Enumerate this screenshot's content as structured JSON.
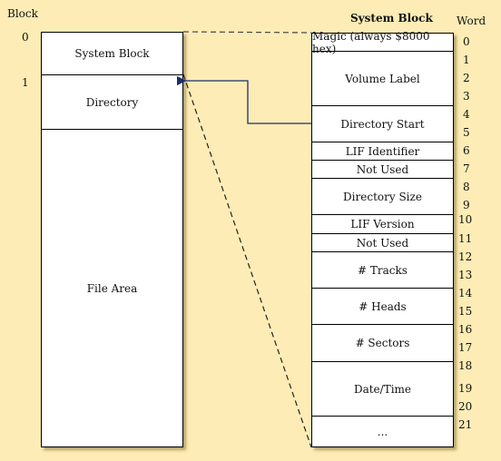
{
  "left": {
    "axis_title": "Block",
    "block_numbers": [
      "0",
      "1"
    ],
    "regions": [
      "System Block",
      "Directory",
      "File Area"
    ]
  },
  "right": {
    "title": "System Block",
    "axis_title": "Word",
    "fields": [
      {
        "label": "Magic (always $8000 hex)"
      },
      {
        "label": "Volume Label"
      },
      {
        "label": "Directory Start"
      },
      {
        "label": "LIF Identifier"
      },
      {
        "label": "Not Used"
      },
      {
        "label": "Directory Size"
      },
      {
        "label": "LIF Version"
      },
      {
        "label": "Not Used"
      },
      {
        "label": "# Tracks"
      },
      {
        "label": "# Heads"
      },
      {
        "label": "# Sectors"
      },
      {
        "label": "Date/Time"
      },
      {
        "label": "..."
      }
    ],
    "words": [
      "0",
      "1",
      "2",
      "3",
      "4",
      "5",
      "6",
      "7",
      "8",
      "9",
      "10",
      "11",
      "12",
      "13",
      "14",
      "15",
      "16",
      "17",
      "18",
      "19",
      "20",
      "21"
    ]
  },
  "colors": {
    "background": "#fdecb5",
    "arrow": "#1a2f6b"
  }
}
